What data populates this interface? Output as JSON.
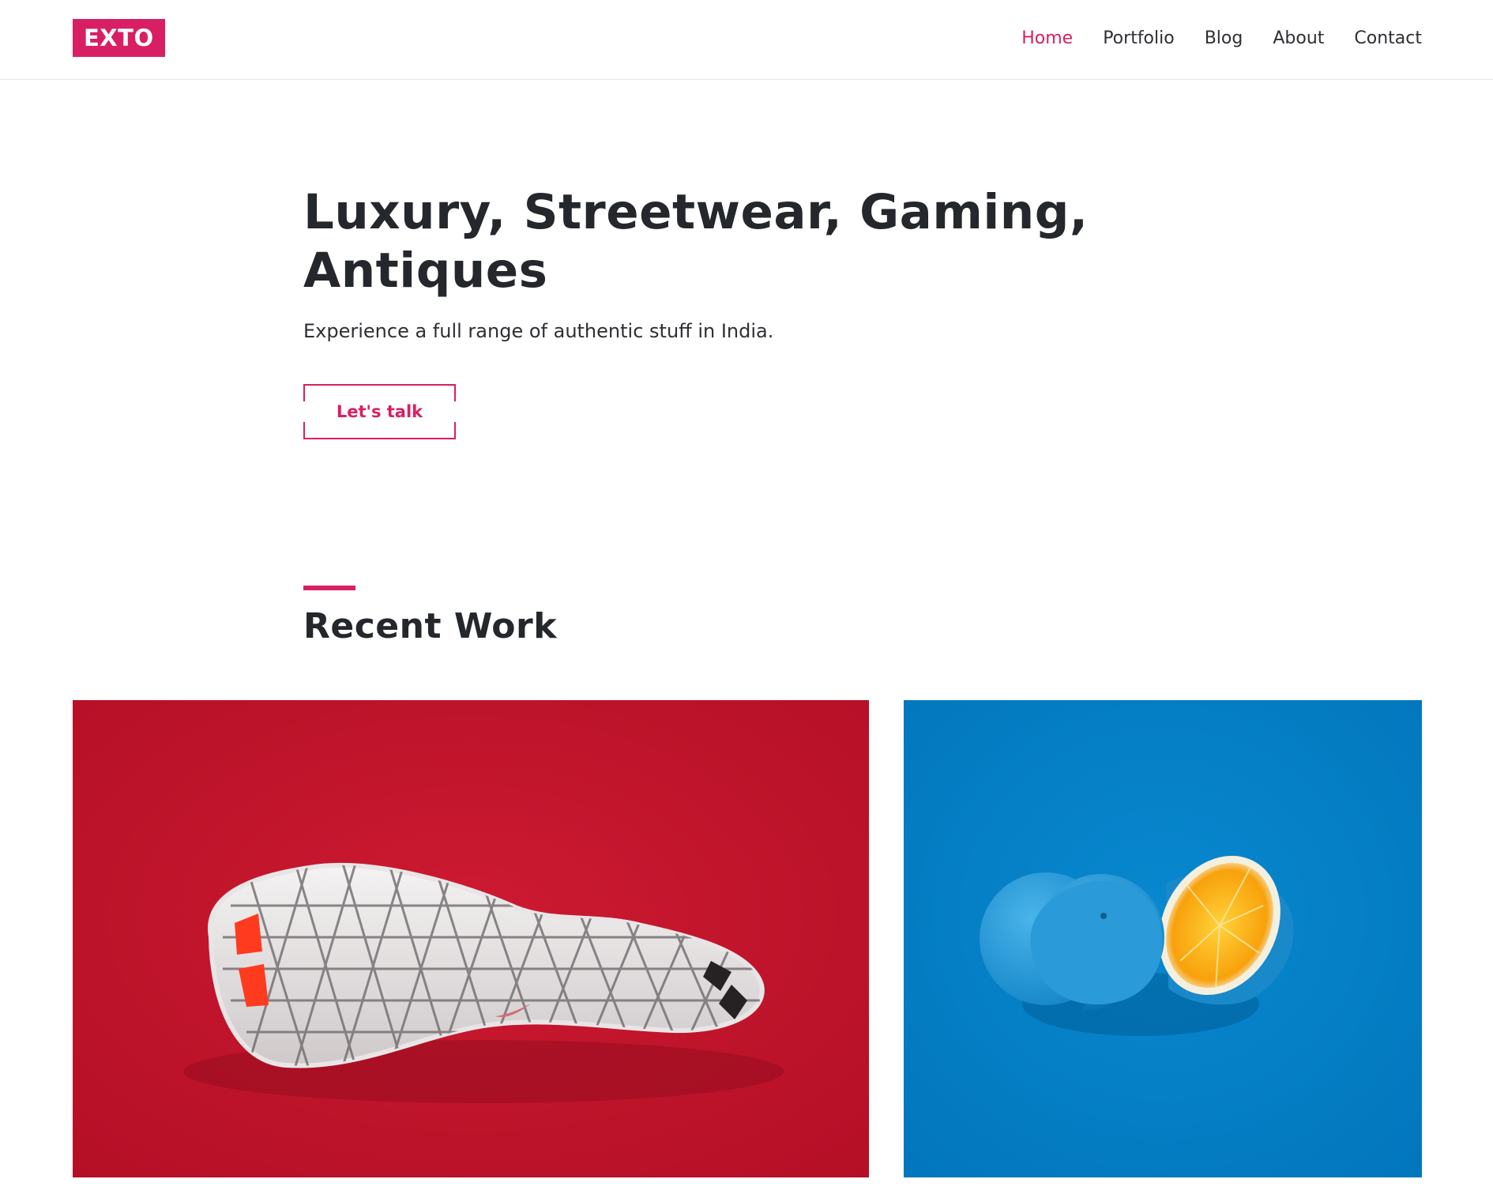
{
  "header": {
    "logo": "EXTO",
    "nav": [
      {
        "label": "Home",
        "active": true
      },
      {
        "label": "Portfolio",
        "active": false
      },
      {
        "label": "Blog",
        "active": false
      },
      {
        "label": "About",
        "active": false
      },
      {
        "label": "Contact",
        "active": false
      }
    ]
  },
  "hero": {
    "title_line1": "Luxury, Streetwear, Gaming,",
    "title_line2": "Antiques",
    "subtitle": "Experience a full range of authentic stuff in India.",
    "cta_label": "Let's talk"
  },
  "recent_work": {
    "title": "Recent Work",
    "items": [
      {
        "image": "white-sneaker-sole-on-red",
        "background": "#c4142c"
      },
      {
        "image": "blue-painted-orange-on-blue",
        "background": "#0280c6"
      }
    ]
  },
  "colors": {
    "accent": "#d81f63",
    "text": "#24272b"
  }
}
